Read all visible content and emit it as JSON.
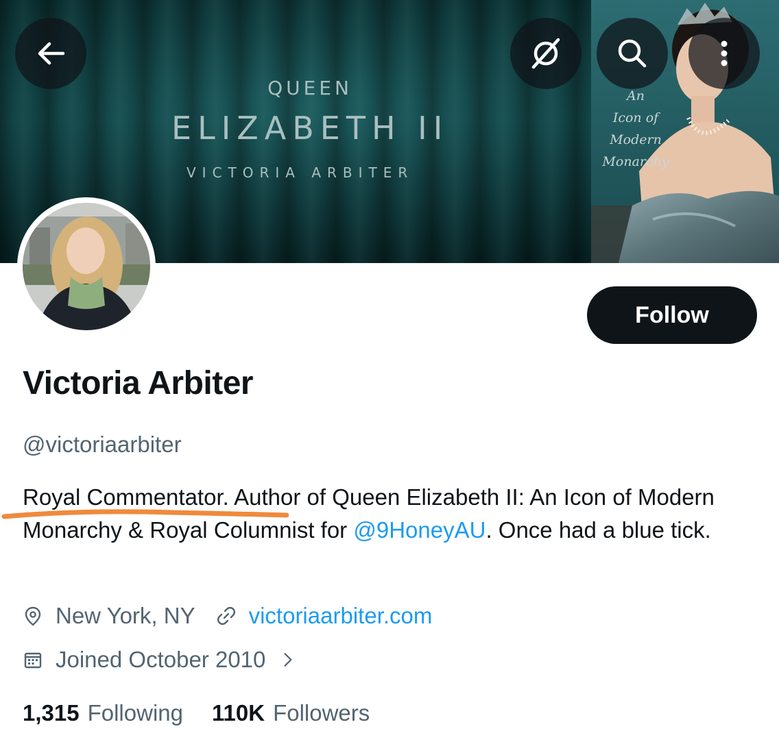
{
  "banner": {
    "cover_small": "QUEEN",
    "cover_big": "ELIZABETH II",
    "cover_author": "VICTORIA ARBITER",
    "cover_subtitle": [
      "An",
      "Icon of",
      "Modern",
      "Monarchy"
    ]
  },
  "toolbar": {
    "back_icon": "back-arrow-icon",
    "grok_icon": "grok-icon",
    "search_icon": "search-icon",
    "more_icon": "more-vertical-icon"
  },
  "profile": {
    "name": "Victoria Arbiter",
    "handle": "@victoriaarbiter",
    "follow_label": "Follow",
    "bio_part1": "Royal Commentator. Author of Queen Elizabeth II: An Icon of Modern Monarchy & Royal Columnist for ",
    "bio_mention": "@9HoneyAU",
    "bio_part2": ". Once had a blue tick.",
    "location": "New York, NY",
    "website": "victoriaarbiter.com",
    "joined": "Joined October 2010",
    "following_count": "1,315",
    "following_label": "Following",
    "followers_count": "110K",
    "followers_label": "Followers"
  },
  "colors": {
    "accent": "#1d9bf0",
    "text_primary": "#0f1419",
    "text_secondary": "#536471",
    "annotation": "#f08a3c"
  }
}
